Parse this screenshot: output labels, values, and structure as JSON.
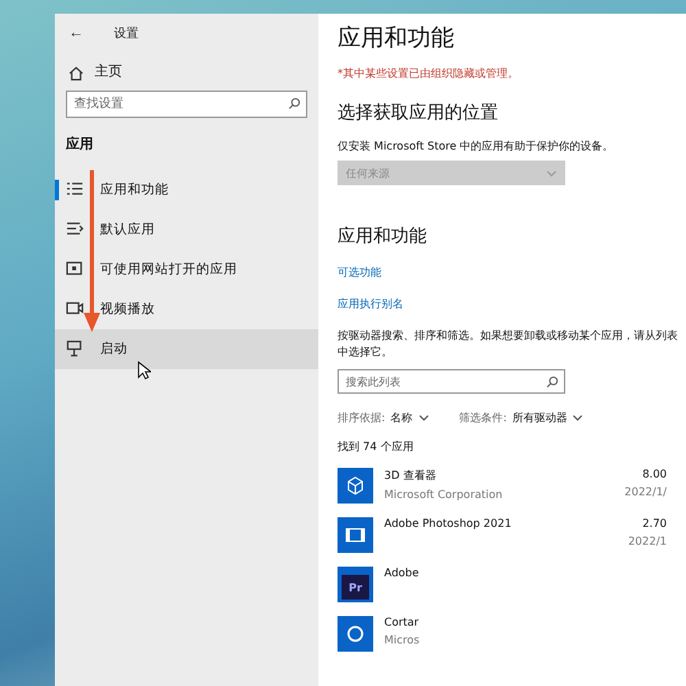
{
  "window": {
    "title": "设置",
    "back": "←"
  },
  "sidebar": {
    "home": "主页",
    "search": {
      "placeholder": "查找设置"
    },
    "section": "应用",
    "items": [
      {
        "label": "应用和功能",
        "kind": "list",
        "selected": true,
        "hovered": false
      },
      {
        "label": "默认应用",
        "kind": "defaults",
        "selected": false,
        "hovered": false
      },
      {
        "label": "可使用网站打开的应用",
        "kind": "web",
        "selected": false,
        "hovered": false
      },
      {
        "label": "视频播放",
        "kind": "video",
        "selected": false,
        "hovered": false
      },
      {
        "label": "启动",
        "kind": "startup",
        "selected": false,
        "hovered": true
      }
    ]
  },
  "main": {
    "title": "应用和功能",
    "notice": "*其中某些设置已由组织隐藏或管理。",
    "location": {
      "heading": "选择获取应用的位置",
      "description": "仅安装 Microsoft Store 中的应用有助于保护你的设备。",
      "dropdown": {
        "value": "任何来源",
        "disabled": true
      }
    },
    "apps": {
      "heading": "应用和功能",
      "links": [
        "可选功能",
        "应用执行别名"
      ],
      "description": "按驱动器搜索、排序和筛选。如果想要卸载或移动某个应用，请从列表中选择它。",
      "search": {
        "placeholder": "搜索此列表"
      },
      "sort": {
        "label": "排序依据:",
        "value": "名称"
      },
      "filter": {
        "label": "筛选条件:",
        "value": "所有驱动器"
      },
      "count": "找到 74 个应用",
      "items": [
        {
          "kind": "cube",
          "name": "3D 查看器",
          "publisher": "Microsoft Corporation",
          "size": "8.00",
          "date": "2022/1/"
        },
        {
          "kind": "film",
          "name": "Adobe Photoshop 2021",
          "size": "2.70",
          "date": "2022/1"
        },
        {
          "kind": "premiere",
          "icon_text": "Pr",
          "name": "Adobe"
        },
        {
          "kind": "circle",
          "name": "Cortar",
          "publisher": "Micros"
        }
      ]
    }
  }
}
